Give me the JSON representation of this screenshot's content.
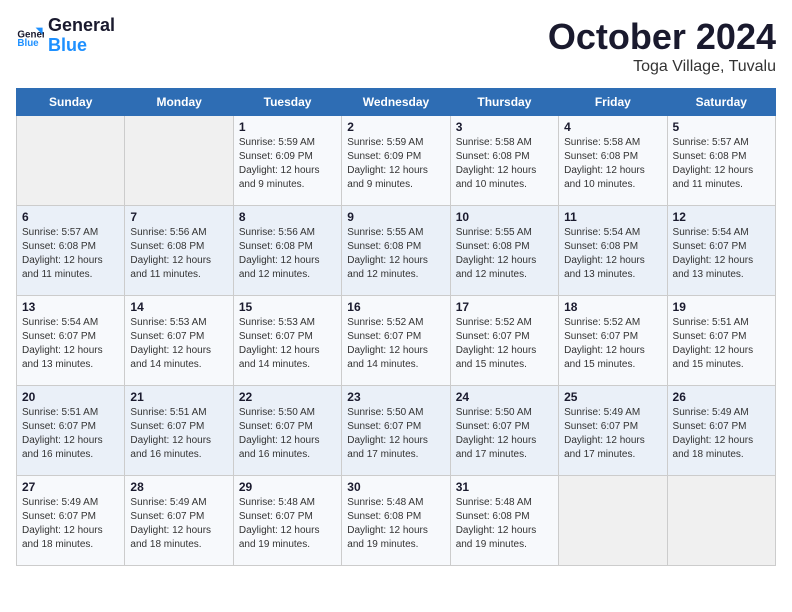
{
  "header": {
    "logo_line1": "General",
    "logo_line2": "Blue",
    "month": "October 2024",
    "location": "Toga Village, Tuvalu"
  },
  "weekdays": [
    "Sunday",
    "Monday",
    "Tuesday",
    "Wednesday",
    "Thursday",
    "Friday",
    "Saturday"
  ],
  "weeks": [
    [
      {
        "day": "",
        "info": ""
      },
      {
        "day": "",
        "info": ""
      },
      {
        "day": "1",
        "info": "Sunrise: 5:59 AM\nSunset: 6:09 PM\nDaylight: 12 hours and 9 minutes."
      },
      {
        "day": "2",
        "info": "Sunrise: 5:59 AM\nSunset: 6:09 PM\nDaylight: 12 hours and 9 minutes."
      },
      {
        "day": "3",
        "info": "Sunrise: 5:58 AM\nSunset: 6:08 PM\nDaylight: 12 hours and 10 minutes."
      },
      {
        "day": "4",
        "info": "Sunrise: 5:58 AM\nSunset: 6:08 PM\nDaylight: 12 hours and 10 minutes."
      },
      {
        "day": "5",
        "info": "Sunrise: 5:57 AM\nSunset: 6:08 PM\nDaylight: 12 hours and 11 minutes."
      }
    ],
    [
      {
        "day": "6",
        "info": "Sunrise: 5:57 AM\nSunset: 6:08 PM\nDaylight: 12 hours and 11 minutes."
      },
      {
        "day": "7",
        "info": "Sunrise: 5:56 AM\nSunset: 6:08 PM\nDaylight: 12 hours and 11 minutes."
      },
      {
        "day": "8",
        "info": "Sunrise: 5:56 AM\nSunset: 6:08 PM\nDaylight: 12 hours and 12 minutes."
      },
      {
        "day": "9",
        "info": "Sunrise: 5:55 AM\nSunset: 6:08 PM\nDaylight: 12 hours and 12 minutes."
      },
      {
        "day": "10",
        "info": "Sunrise: 5:55 AM\nSunset: 6:08 PM\nDaylight: 12 hours and 12 minutes."
      },
      {
        "day": "11",
        "info": "Sunrise: 5:54 AM\nSunset: 6:08 PM\nDaylight: 12 hours and 13 minutes."
      },
      {
        "day": "12",
        "info": "Sunrise: 5:54 AM\nSunset: 6:07 PM\nDaylight: 12 hours and 13 minutes."
      }
    ],
    [
      {
        "day": "13",
        "info": "Sunrise: 5:54 AM\nSunset: 6:07 PM\nDaylight: 12 hours and 13 minutes."
      },
      {
        "day": "14",
        "info": "Sunrise: 5:53 AM\nSunset: 6:07 PM\nDaylight: 12 hours and 14 minutes."
      },
      {
        "day": "15",
        "info": "Sunrise: 5:53 AM\nSunset: 6:07 PM\nDaylight: 12 hours and 14 minutes."
      },
      {
        "day": "16",
        "info": "Sunrise: 5:52 AM\nSunset: 6:07 PM\nDaylight: 12 hours and 14 minutes."
      },
      {
        "day": "17",
        "info": "Sunrise: 5:52 AM\nSunset: 6:07 PM\nDaylight: 12 hours and 15 minutes."
      },
      {
        "day": "18",
        "info": "Sunrise: 5:52 AM\nSunset: 6:07 PM\nDaylight: 12 hours and 15 minutes."
      },
      {
        "day": "19",
        "info": "Sunrise: 5:51 AM\nSunset: 6:07 PM\nDaylight: 12 hours and 15 minutes."
      }
    ],
    [
      {
        "day": "20",
        "info": "Sunrise: 5:51 AM\nSunset: 6:07 PM\nDaylight: 12 hours and 16 minutes."
      },
      {
        "day": "21",
        "info": "Sunrise: 5:51 AM\nSunset: 6:07 PM\nDaylight: 12 hours and 16 minutes."
      },
      {
        "day": "22",
        "info": "Sunrise: 5:50 AM\nSunset: 6:07 PM\nDaylight: 12 hours and 16 minutes."
      },
      {
        "day": "23",
        "info": "Sunrise: 5:50 AM\nSunset: 6:07 PM\nDaylight: 12 hours and 17 minutes."
      },
      {
        "day": "24",
        "info": "Sunrise: 5:50 AM\nSunset: 6:07 PM\nDaylight: 12 hours and 17 minutes."
      },
      {
        "day": "25",
        "info": "Sunrise: 5:49 AM\nSunset: 6:07 PM\nDaylight: 12 hours and 17 minutes."
      },
      {
        "day": "26",
        "info": "Sunrise: 5:49 AM\nSunset: 6:07 PM\nDaylight: 12 hours and 18 minutes."
      }
    ],
    [
      {
        "day": "27",
        "info": "Sunrise: 5:49 AM\nSunset: 6:07 PM\nDaylight: 12 hours and 18 minutes."
      },
      {
        "day": "28",
        "info": "Sunrise: 5:49 AM\nSunset: 6:07 PM\nDaylight: 12 hours and 18 minutes."
      },
      {
        "day": "29",
        "info": "Sunrise: 5:48 AM\nSunset: 6:07 PM\nDaylight: 12 hours and 19 minutes."
      },
      {
        "day": "30",
        "info": "Sunrise: 5:48 AM\nSunset: 6:08 PM\nDaylight: 12 hours and 19 minutes."
      },
      {
        "day": "31",
        "info": "Sunrise: 5:48 AM\nSunset: 6:08 PM\nDaylight: 12 hours and 19 minutes."
      },
      {
        "day": "",
        "info": ""
      },
      {
        "day": "",
        "info": ""
      }
    ]
  ]
}
